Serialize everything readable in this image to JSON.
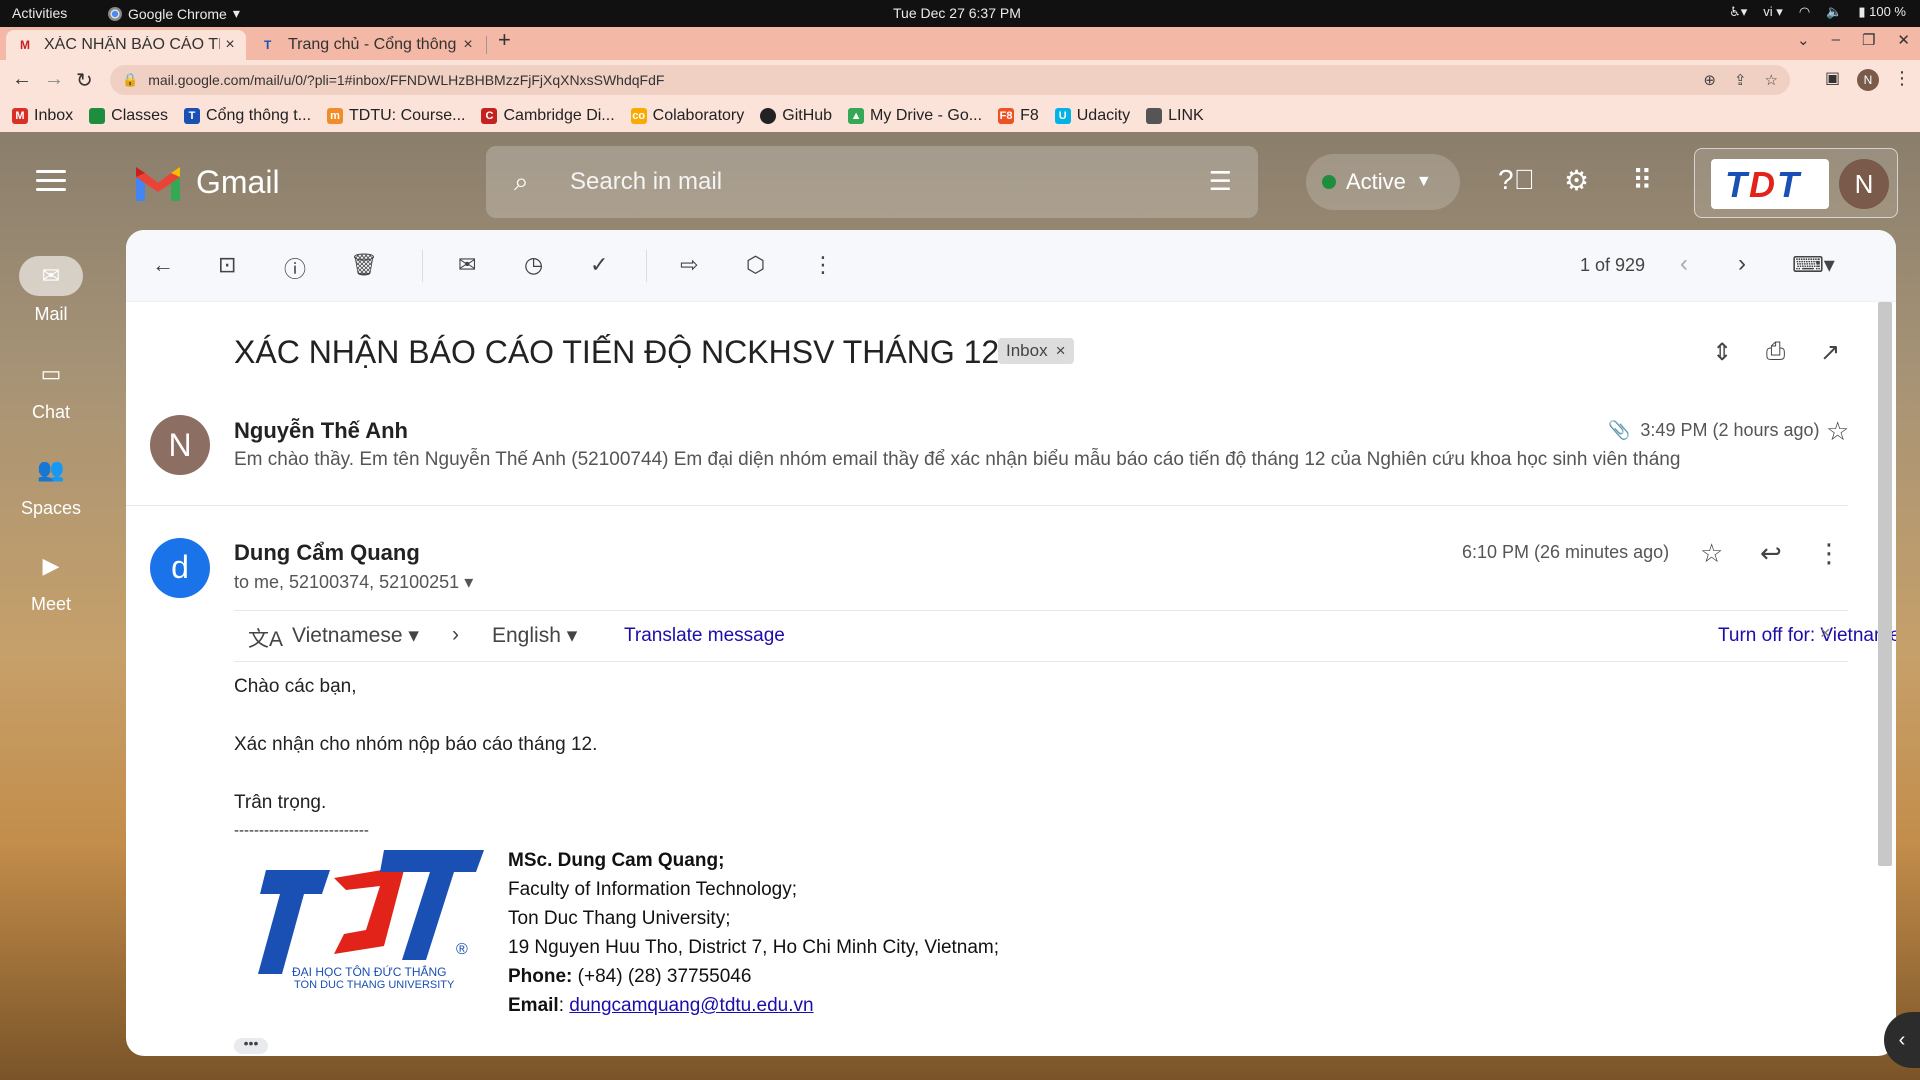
{
  "os": {
    "activities": "Activities",
    "app_name": "Google Chrome",
    "clock": "Tue Dec 27   6:37 PM",
    "lang": "vi",
    "battery": "100 %"
  },
  "browser": {
    "tabs": [
      {
        "title": "XÁC NHẬN BÁO CÁO TI",
        "active": true
      },
      {
        "title": "Trang chủ - Cổng thông",
        "active": false
      }
    ],
    "url": "mail.google.com/mail/u/0/?pli=1#inbox/FFNDWLHzBHBMzzFjFjXqXNxsSWhdqFdF",
    "profile_initial": "N",
    "bookmarks": [
      {
        "label": "Inbox",
        "icon": "gmail-icon",
        "color": "#d93025"
      },
      {
        "label": "Classes",
        "icon": "classroom-icon",
        "color": "#1e8e3e"
      },
      {
        "label": "Cổng thông t...",
        "icon": "tdtu-icon",
        "color": "#1a4fb4"
      },
      {
        "label": "TDTU: Course...",
        "icon": "moodle-icon",
        "color": "#f28c28"
      },
      {
        "label": "Cambridge Di...",
        "icon": "cambridge-icon",
        "color": "#c5221f"
      },
      {
        "label": "Colaboratory",
        "icon": "colab-icon",
        "color": "#f9ab00"
      },
      {
        "label": "GitHub",
        "icon": "github-icon",
        "color": "#222222"
      },
      {
        "label": "My Drive - Go...",
        "icon": "drive-icon",
        "color": "#34a853"
      },
      {
        "label": "F8",
        "icon": "f8-icon",
        "color": "#f05123"
      },
      {
        "label": "Udacity",
        "icon": "udacity-icon",
        "color": "#02b3e4"
      },
      {
        "label": "LINK",
        "icon": "folder-icon",
        "color": "#555555"
      }
    ]
  },
  "gmail": {
    "logo_text": "Gmail",
    "search_placeholder": "Search in mail",
    "status": "Active",
    "account_initial": "N",
    "rail": [
      {
        "label": "Mail",
        "icon": "mail-icon",
        "selected": true
      },
      {
        "label": "Chat",
        "icon": "chat-icon",
        "selected": false
      },
      {
        "label": "Spaces",
        "icon": "spaces-icon",
        "selected": false
      },
      {
        "label": "Meet",
        "icon": "meet-icon",
        "selected": false
      }
    ],
    "pager": "1 of 929"
  },
  "thread": {
    "subject": "XÁC NHẬN BÁO CÁO TIẾN ĐỘ NCKHSV THÁNG 12",
    "label": "Inbox",
    "message1": {
      "avatar": "N",
      "sender": "Nguyễn Thế Anh",
      "snippet": "Em chào thầy. Em tên Nguyễn Thế Anh (52100744) Em đại diện nhóm email thầy để xác nhận biểu mẫu báo cáo tiến độ tháng 12 của Nghiên cứu khoa học sinh viên tháng",
      "time": "3:49 PM (2 hours ago)"
    },
    "message2": {
      "avatar": "d",
      "sender": "Dung Cẩm Quang",
      "to": "to me, 52100374, 52100251",
      "time": "6:10 PM (26 minutes ago)",
      "translate": {
        "from": "Vietnamese",
        "to": "English",
        "action": "Translate message",
        "turn_off": "Turn off for: Vietnamese"
      },
      "body": [
        "Chào các bạn,",
        "Xác nhận cho nhóm nộp báo cáo tháng 12.",
        "Trân trọng.",
        "---------------------------"
      ],
      "signature": {
        "name": "MSc. Dung Cam Quang;",
        "faculty": "Faculty of Information Technology;",
        "university": "Ton Duc Thang University;",
        "address": "19 Nguyen Huu Tho, District 7, Ho Chi Minh City, Vietnam;",
        "phone_label": "Phone:",
        "phone": " (+84) (28) 37755046",
        "email_label": "Email",
        "email": "dungcamquang@tdtu.edu.vn",
        "logo_text_1": "ĐẠI HỌC TÔN ĐỨC THẮNG",
        "logo_text_2": "TON DUC THANG UNIVERSITY"
      }
    }
  }
}
